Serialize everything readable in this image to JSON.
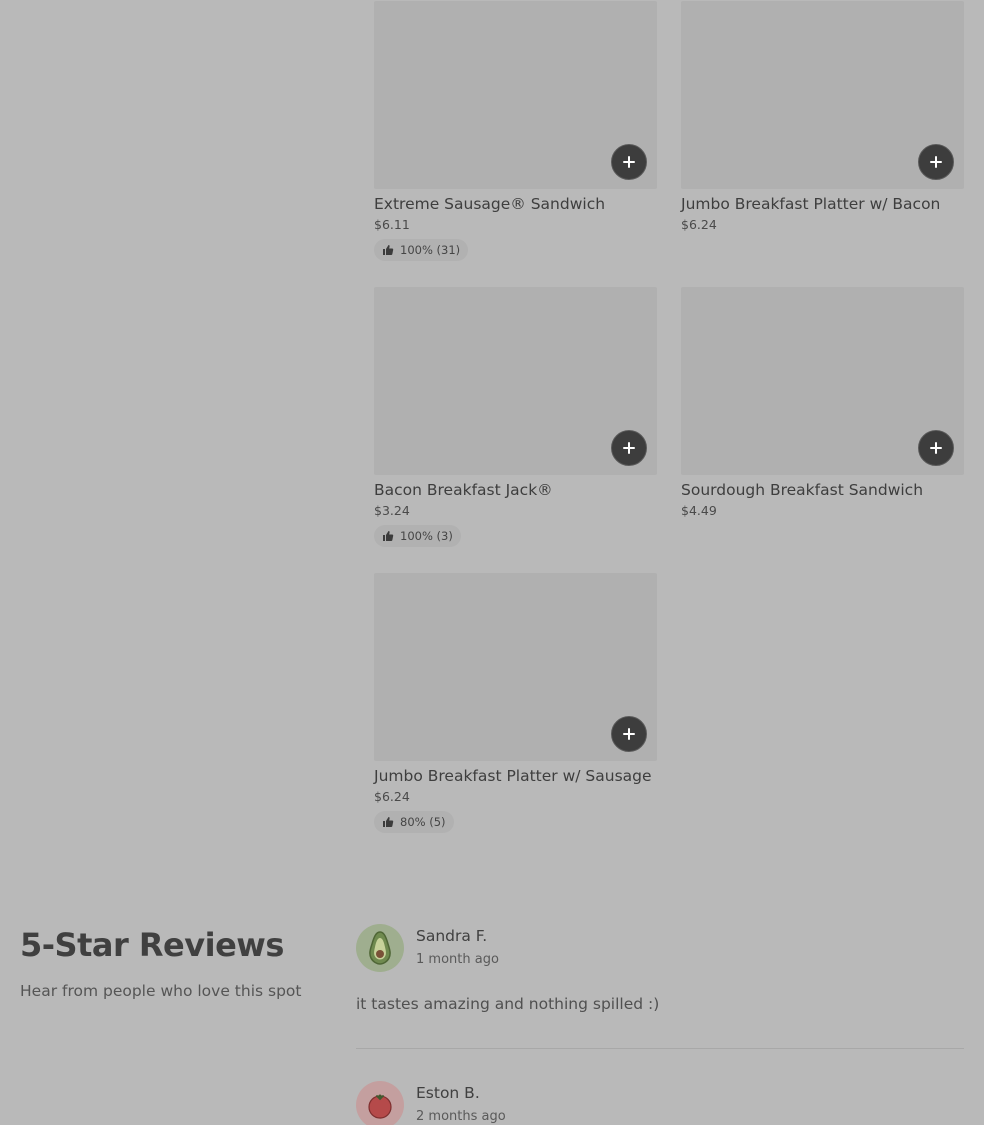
{
  "menu_items": [
    {
      "name": "Extreme Sausage® Sandwich",
      "price": "$6.11",
      "rating": "100% (31)"
    },
    {
      "name": "Jumbo Breakfast Platter w/ Bacon",
      "price": "$6.24",
      "rating": null
    },
    {
      "name": "Bacon Breakfast Jack®",
      "price": "$3.24",
      "rating": "100% (3)"
    },
    {
      "name": "Sourdough Breakfast Sandwich",
      "price": "$4.49",
      "rating": null
    },
    {
      "name": "Jumbo Breakfast Platter w/ Sausage",
      "price": "$6.24",
      "rating": "80% (5)"
    }
  ],
  "icons": {
    "add": "plus-icon",
    "rating": "thumbs-up-icon",
    "avatar1": "avocado-icon",
    "avatar2": "tomato-icon"
  },
  "reviews_section": {
    "title": "5-Star Reviews",
    "subtitle": "Hear from people who love this spot"
  },
  "reviews": [
    {
      "name": "Sandra F.",
      "time": "1 month ago",
      "text": "it tastes amazing and nothing spilled :)"
    },
    {
      "name": "Eston B.",
      "time": "2 months ago",
      "text": ""
    }
  ],
  "colors": {
    "overlay_background": "#b9b9b9",
    "image_placeholder": "#b0b0b0",
    "add_button": "#3d3d3d"
  }
}
